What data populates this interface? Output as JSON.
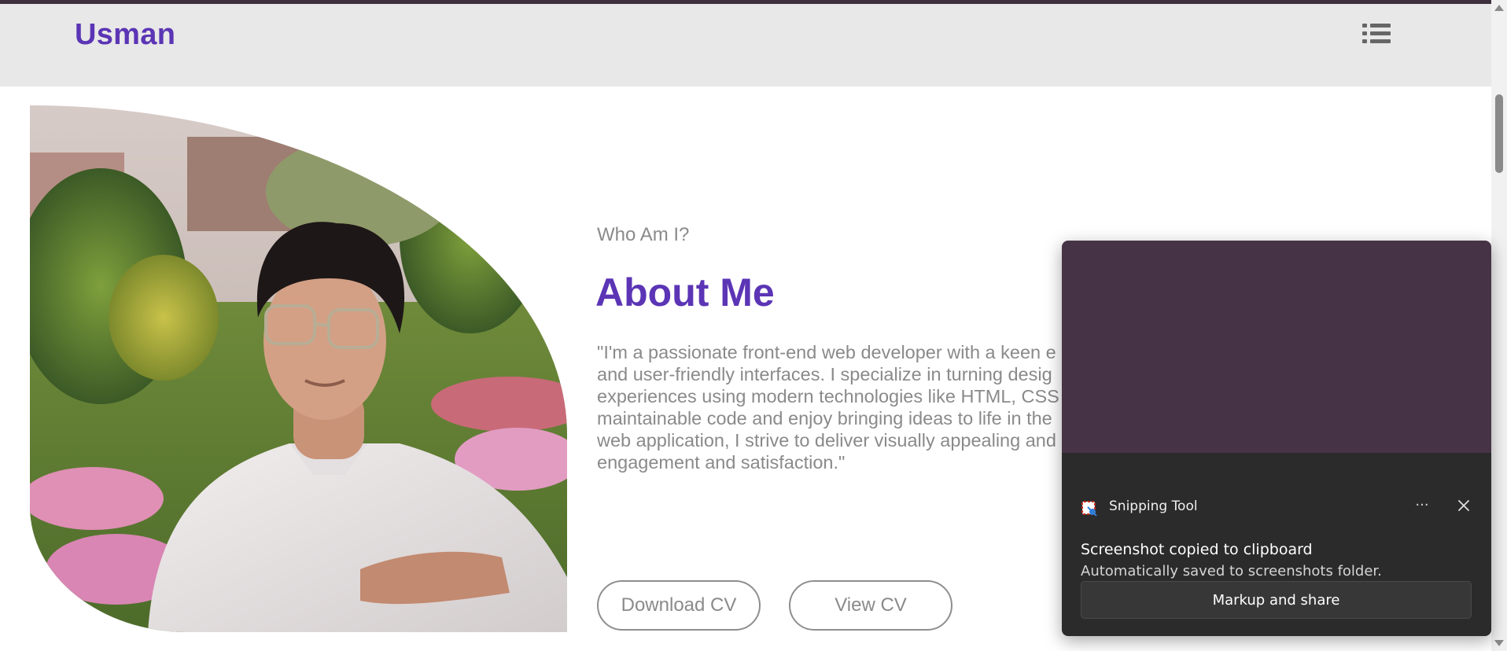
{
  "navbar": {
    "brand": "Usman",
    "menu_icon": "list-menu-icon"
  },
  "about": {
    "subtitle": "Who Am I?",
    "heading": "About Me",
    "paragraph_lines": [
      "\"I'm a passionate front-end web developer with a keen e",
      "and user-friendly interfaces. I specialize in turning desig",
      "experiences using modern technologies like HTML, CSS",
      "maintainable code and enjoy bringing ideas to life in the",
      "web application, I strive to deliver visually appealing and",
      "engagement and satisfaction.\""
    ],
    "buttons": {
      "download": "Download CV",
      "view": "View CV"
    }
  },
  "toast": {
    "app_name": "Snipping Tool",
    "more_label": "···",
    "title": "Screenshot copied to clipboard",
    "message": "Automatically saved to screenshots folder.",
    "action": "Markup and share"
  },
  "colors": {
    "accent": "#5b35b5",
    "navbar_bg": "#e8e8e8",
    "body_text": "#8a8a8a",
    "toast_bg": "#2b2b2b",
    "toast_preview": "#463446"
  }
}
